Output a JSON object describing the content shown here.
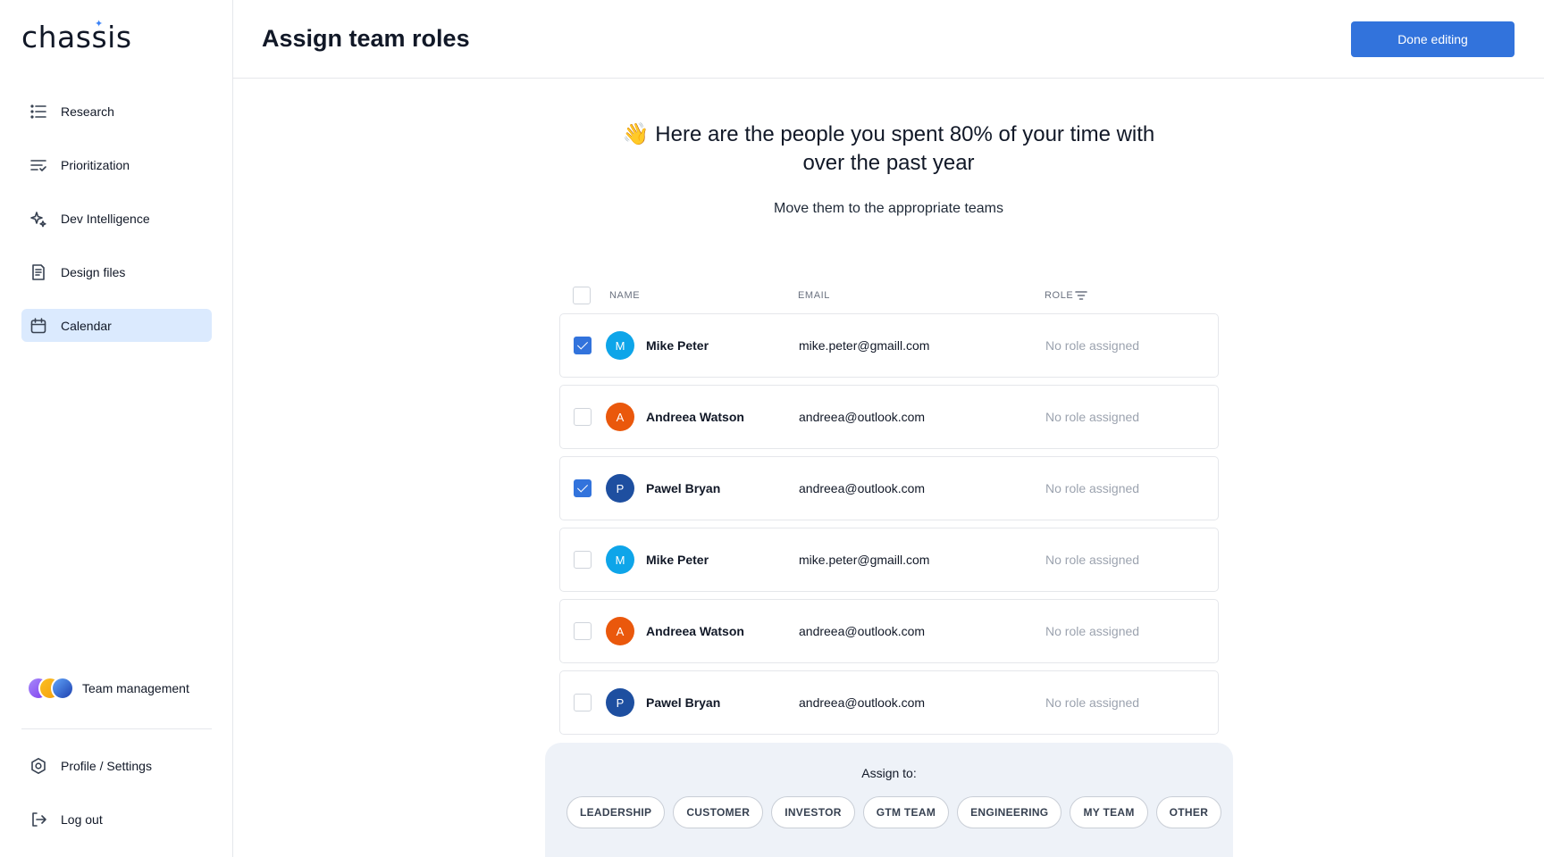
{
  "app": {
    "logo": "chassis"
  },
  "sidebar": {
    "items": [
      {
        "label": "Research",
        "icon": "list-icon",
        "active": false
      },
      {
        "label": "Prioritization",
        "icon": "filter-lines-icon",
        "active": false
      },
      {
        "label": "Dev Intelligence",
        "icon": "sparkles-icon",
        "active": false
      },
      {
        "label": "Design files",
        "icon": "document-icon",
        "active": false
      },
      {
        "label": "Calendar",
        "icon": "calendar-icon",
        "active": true
      }
    ],
    "team_label": "Team management",
    "bottom_items": [
      {
        "label": "Profile / Settings",
        "icon": "settings-icon"
      },
      {
        "label": "Log out",
        "icon": "logout-icon"
      }
    ]
  },
  "header": {
    "title": "Assign team roles",
    "done_label": "Done editing"
  },
  "hero": {
    "emoji": "👋",
    "heading": "Here are the people you spent 80% of your time with over the past year",
    "subheading": "Move them to the appropriate teams"
  },
  "table": {
    "columns": {
      "name": "NAME",
      "email": "EMAIL",
      "role": "ROLE"
    },
    "rows": [
      {
        "initial": "M",
        "name": "Mike Peter",
        "email": "mike.peter@gmaill.com",
        "role": "No role assigned",
        "checked": true,
        "color": "#0ea5e9"
      },
      {
        "initial": "A",
        "name": "Andreea Watson",
        "email": "andreea@outlook.com",
        "role": "No role assigned",
        "checked": false,
        "color": "#ea580c"
      },
      {
        "initial": "P",
        "name": "Pawel Bryan",
        "email": "andreea@outlook.com",
        "role": "No role assigned",
        "checked": true,
        "color": "#1e4fa0"
      },
      {
        "initial": "M",
        "name": "Mike Peter",
        "email": "mike.peter@gmaill.com",
        "role": "No role assigned",
        "checked": false,
        "color": "#0ea5e9"
      },
      {
        "initial": "A",
        "name": "Andreea Watson",
        "email": "andreea@outlook.com",
        "role": "No role assigned",
        "checked": false,
        "color": "#ea580c"
      },
      {
        "initial": "P",
        "name": "Pawel Bryan",
        "email": "andreea@outlook.com",
        "role": "No role assigned",
        "checked": false,
        "color": "#1e4fa0"
      }
    ]
  },
  "assign": {
    "title": "Assign to:",
    "tags": [
      "LEADERSHIP",
      "CUSTOMER",
      "INVESTOR",
      "GTM TEAM",
      "ENGINEERING",
      "MY TEAM",
      "OTHER"
    ]
  },
  "colors": {
    "primary": "#3273dc",
    "active_nav": "#dbeafe",
    "panel": "#eef2f8"
  }
}
